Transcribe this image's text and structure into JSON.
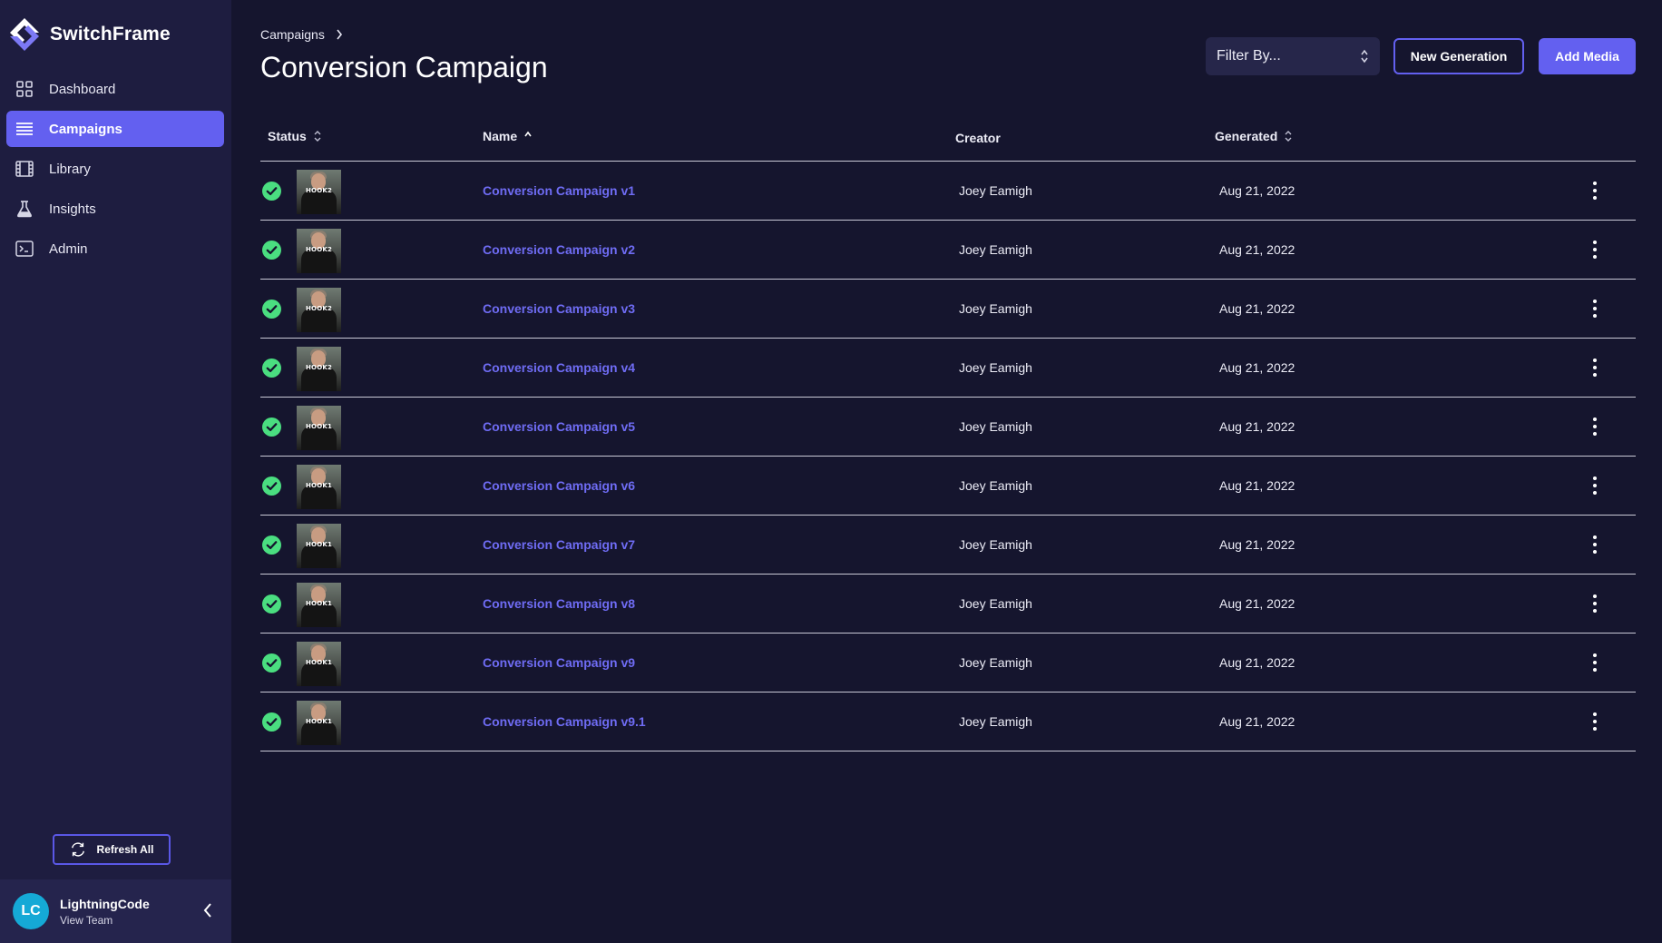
{
  "brand": {
    "name": "SwitchFrame"
  },
  "sidebar": {
    "items": [
      {
        "label": "Dashboard",
        "icon": "grid-icon",
        "active": false
      },
      {
        "label": "Campaigns",
        "icon": "list-icon",
        "active": true
      },
      {
        "label": "Library",
        "icon": "film-icon",
        "active": false
      },
      {
        "label": "Insights",
        "icon": "flask-icon",
        "active": false
      },
      {
        "label": "Admin",
        "icon": "terminal-icon",
        "active": false
      }
    ],
    "refresh_label": "Refresh All",
    "user": {
      "initials": "LC",
      "name": "LightningCode",
      "sub": "View Team"
    }
  },
  "header": {
    "breadcrumb": "Campaigns",
    "title": "Conversion Campaign",
    "filter_placeholder": "Filter By...",
    "new_generation_label": "New Generation",
    "add_media_label": "Add Media"
  },
  "table": {
    "columns": {
      "status": "Status",
      "name": "Name",
      "creator": "Creator",
      "generated": "Generated"
    },
    "rows": [
      {
        "name": "Conversion Campaign v1",
        "creator": "Joey Eamigh",
        "generated": "Aug 21, 2022",
        "thumb": "HOOK2"
      },
      {
        "name": "Conversion Campaign v2",
        "creator": "Joey Eamigh",
        "generated": "Aug 21, 2022",
        "thumb": "HOOK2"
      },
      {
        "name": "Conversion Campaign v3",
        "creator": "Joey Eamigh",
        "generated": "Aug 21, 2022",
        "thumb": "HOOK2"
      },
      {
        "name": "Conversion Campaign v4",
        "creator": "Joey Eamigh",
        "generated": "Aug 21, 2022",
        "thumb": "HOOK2"
      },
      {
        "name": "Conversion Campaign v5",
        "creator": "Joey Eamigh",
        "generated": "Aug 21, 2022",
        "thumb": "HOOK1"
      },
      {
        "name": "Conversion Campaign v6",
        "creator": "Joey Eamigh",
        "generated": "Aug 21, 2022",
        "thumb": "HOOK1"
      },
      {
        "name": "Conversion Campaign v7",
        "creator": "Joey Eamigh",
        "generated": "Aug 21, 2022",
        "thumb": "HOOK1"
      },
      {
        "name": "Conversion Campaign v8",
        "creator": "Joey Eamigh",
        "generated": "Aug 21, 2022",
        "thumb": "HOOK1"
      },
      {
        "name": "Conversion Campaign v9",
        "creator": "Joey Eamigh",
        "generated": "Aug 21, 2022",
        "thumb": "HOOK1"
      },
      {
        "name": "Conversion Campaign v9.1",
        "creator": "Joey Eamigh",
        "generated": "Aug 21, 2022",
        "thumb": "HOOK1"
      }
    ]
  },
  "colors": {
    "accent": "#6360f0",
    "link": "#6f6cf4",
    "success": "#4ade80",
    "background": "#15152e",
    "sidebar": "#1e1d40"
  }
}
